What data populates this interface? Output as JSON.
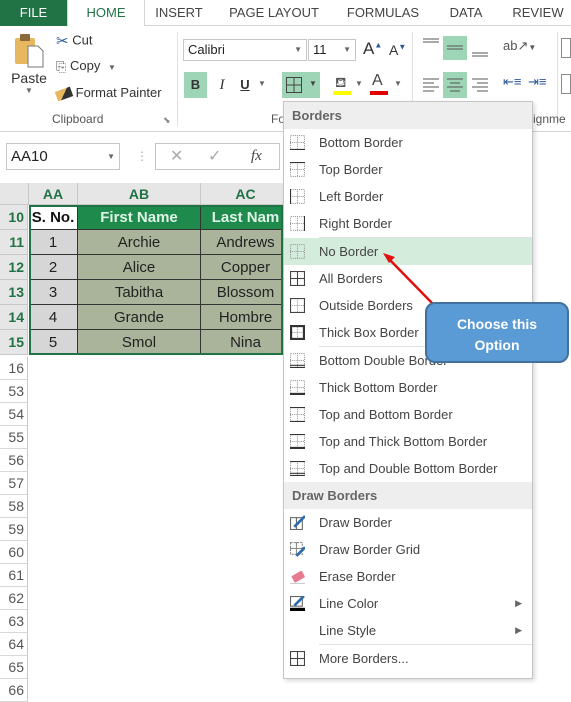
{
  "tabs": [
    {
      "label": "FILE"
    },
    {
      "label": "HOME"
    },
    {
      "label": "INSERT"
    },
    {
      "label": "PAGE LAYOUT"
    },
    {
      "label": "FORMULAS"
    },
    {
      "label": "DATA"
    },
    {
      "label": "REVIEW"
    }
  ],
  "ribbon": {
    "clipboard": {
      "paste": "Paste",
      "cut": "Cut",
      "copy": "Copy",
      "format_painter": "Format Painter",
      "label": "Clipboard"
    },
    "font": {
      "name": "Calibri",
      "size": "11",
      "bold": "B",
      "italic": "I",
      "underline": "U",
      "label": "Fo"
    },
    "alignment": {
      "label": "ignme"
    },
    "colors": {
      "fill": "#ffff00",
      "font": "#e00000",
      "accent": "#217346",
      "highlight": "#9fd5b7"
    }
  },
  "formula_bar": {
    "name_box": "AA10",
    "cancel": "✕",
    "enter": "✓",
    "fx": "fx",
    "value": ""
  },
  "sheet": {
    "columns": [
      "AA",
      "AB",
      "AC"
    ],
    "header_row": {
      "row": "10",
      "cells": [
        "S. No.",
        "First Name",
        "Last Nam"
      ]
    },
    "rows": [
      {
        "row": "11",
        "cells": [
          "1",
          "Archie",
          "Andrews"
        ]
      },
      {
        "row": "12",
        "cells": [
          "2",
          "Alice",
          "Copper"
        ]
      },
      {
        "row": "13",
        "cells": [
          "3",
          "Tabitha",
          "Blossom"
        ]
      },
      {
        "row": "14",
        "cells": [
          "4",
          "Grande",
          "Hombre"
        ]
      },
      {
        "row": "15",
        "cells": [
          "5",
          "Smol",
          "Nina"
        ]
      }
    ],
    "empty_rows": [
      "16",
      "53",
      "54",
      "55",
      "56",
      "57",
      "58",
      "59",
      "60",
      "61",
      "62",
      "63",
      "64",
      "65",
      "66"
    ]
  },
  "menu": {
    "section1": "Borders",
    "items1": [
      {
        "label": "Bottom Border",
        "icon": "bottom-border-icon"
      },
      {
        "label": "Top Border",
        "icon": "top-border-icon"
      },
      {
        "label": "Left Border",
        "icon": "left-border-icon"
      },
      {
        "label": "Right Border",
        "icon": "right-border-icon"
      },
      {
        "label": "No Border",
        "icon": "no-border-icon",
        "hovered": true
      },
      {
        "label": "All Borders",
        "icon": "all-borders-icon"
      },
      {
        "label": "Outside Borders",
        "icon": "outside-borders-icon"
      },
      {
        "label": "Thick Box Border",
        "icon": "thick-box-border-icon"
      },
      {
        "label": "Bottom Double Border",
        "icon": "bottom-double-border-icon"
      },
      {
        "label": "Thick Bottom Border",
        "icon": "thick-bottom-border-icon"
      },
      {
        "label": "Top and Bottom Border",
        "icon": "top-and-bottom-border-icon"
      },
      {
        "label": "Top and Thick Bottom Border",
        "icon": "top-and-thick-bottom-border-icon"
      },
      {
        "label": "Top and Double Bottom Border",
        "icon": "top-and-double-bottom-border-icon"
      }
    ],
    "section2": "Draw Borders",
    "items2": [
      {
        "label": "Draw Border",
        "icon": "draw-border-icon"
      },
      {
        "label": "Draw Border Grid",
        "icon": "draw-border-grid-icon"
      },
      {
        "label": "Erase Border",
        "icon": "eraser-icon"
      },
      {
        "label": "Line Color",
        "icon": "line-color-icon",
        "submenu": true
      },
      {
        "label": "Line Style",
        "icon": "",
        "submenu": true
      },
      {
        "label": "More Borders...",
        "icon": "more-borders-icon"
      }
    ]
  },
  "callout": {
    "line1": "Choose this",
    "line2": "Option"
  }
}
